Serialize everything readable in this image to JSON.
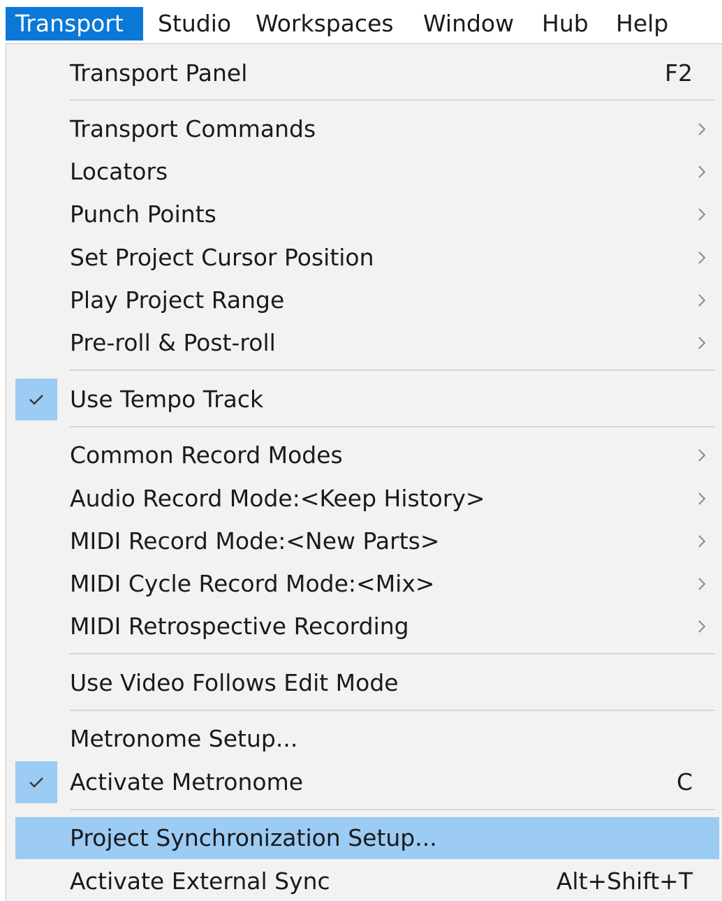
{
  "menubar": {
    "items": [
      "Transport",
      "Studio",
      "Workspaces",
      "Window",
      "Hub",
      "Help"
    ]
  },
  "menu": {
    "items": [
      {
        "label": "Transport Panel",
        "shortcut": "F2"
      },
      {
        "label": "Transport Commands",
        "submenu": true
      },
      {
        "label": "Locators",
        "submenu": true
      },
      {
        "label": "Punch Points",
        "submenu": true
      },
      {
        "label": "Set Project Cursor Position",
        "submenu": true
      },
      {
        "label": "Play Project Range",
        "submenu": true
      },
      {
        "label": "Pre-roll & Post-roll",
        "submenu": true
      },
      {
        "label": "Use Tempo Track",
        "checked": true
      },
      {
        "label": "Common Record Modes",
        "submenu": true
      },
      {
        "label": "Audio Record Mode:<Keep History>",
        "submenu": true
      },
      {
        "label": "MIDI Record Mode:<New Parts>",
        "submenu": true
      },
      {
        "label": "MIDI Cycle Record Mode:<Mix>",
        "submenu": true
      },
      {
        "label": "MIDI Retrospective Recording",
        "submenu": true
      },
      {
        "label": "Use Video Follows Edit Mode"
      },
      {
        "label": "Metronome Setup..."
      },
      {
        "label": "Activate Metronome",
        "checked": true,
        "shortcut": "C"
      },
      {
        "label": "Project Synchronization Setup...",
        "highlighted": true
      },
      {
        "label": "Activate External Sync",
        "shortcut": "Alt+Shift+T"
      }
    ]
  },
  "colors": {
    "menubar_active_bg": "#0a78d7",
    "highlight_bg": "#9ccbf3",
    "menu_bg": "#f2f2f2"
  }
}
